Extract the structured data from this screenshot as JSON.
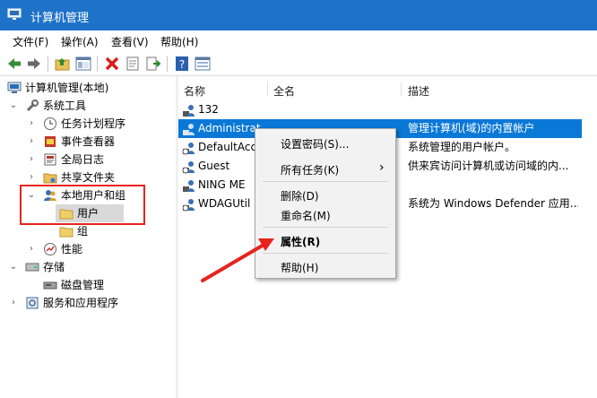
{
  "window": {
    "title": "计算机管理"
  },
  "menu": [
    "文件(F)",
    "操作(A)",
    "查看(V)",
    "帮助(H)"
  ],
  "toolbar": {
    "icons": [
      "back-arrow-icon",
      "forward-arrow-icon",
      "up-folder-icon",
      "show-hide-tree-icon",
      "delete-icon",
      "properties-icon",
      "export-list-icon",
      "help-icon",
      "view-icon"
    ]
  },
  "tree": {
    "root": "计算机管理(本地)",
    "system_tools": "系统工具",
    "task_scheduler": "任务计划程序",
    "event_viewer": "事件查看器",
    "global_log": "全局日志",
    "shared_folders": "共享文件夹",
    "local_users_groups": "本地用户和组",
    "users": "用户",
    "groups": "组",
    "performance": "性能",
    "storage": "存储",
    "disk_management": "磁盘管理",
    "services_apps": "服务和应用程序"
  },
  "columns": {
    "name": "名称",
    "fullname": "全名",
    "description": "描述"
  },
  "users": [
    {
      "name": "132",
      "description": ""
    },
    {
      "name": "Administrat",
      "description": "管理计算机(域)的内置帐户"
    },
    {
      "name": "DefaultAcc",
      "description": "系统管理的用户帐户。"
    },
    {
      "name": "Guest",
      "description": "供来宾访问计算机或访问域的内..."
    },
    {
      "name": "NING ME",
      "description": ""
    },
    {
      "name": "WDAGUtil",
      "description": "系统为 Windows Defender 应用..."
    }
  ],
  "context_menu": {
    "set_password": "设置密码(S)...",
    "all_tasks": "所有任务(K)",
    "all_tasks_arrow": "›",
    "delete": "删除(D)",
    "rename": "重命名(M)",
    "properties": "属性(R)",
    "help": "帮助(H)"
  },
  "colors": {
    "titlebar": "#1e73c8",
    "selection": "#0a78d7",
    "annotation": "#e8231c"
  }
}
